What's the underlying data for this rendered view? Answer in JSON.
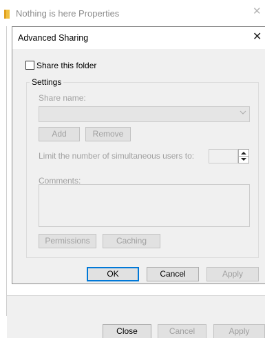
{
  "outer_window": {
    "title": "Nothing is here Properties",
    "close_glyph": "✕",
    "folder_icon": "folder-icon",
    "buttons": {
      "close": "Close",
      "cancel": "Cancel",
      "apply": "Apply"
    }
  },
  "dialog": {
    "title": "Advanced Sharing",
    "close_glyph": "✕",
    "share_checkbox": {
      "label": "Share this folder",
      "checked": false
    },
    "settings": {
      "legend": "Settings",
      "share_name_label": "Share name:",
      "share_name_value": "",
      "add_label": "Add",
      "remove_label": "Remove",
      "limit_label": "Limit the number of simultaneous users to:",
      "limit_value": "",
      "comments_label": "Comments:",
      "comments_value": "",
      "permissions_label": "Permissions",
      "caching_label": "Caching"
    },
    "buttons": {
      "ok": "OK",
      "cancel": "Cancel",
      "apply": "Apply"
    }
  },
  "colors": {
    "dialog_bg": "#f0f0f0",
    "disabled_text": "#a0a0a0",
    "default_button_border": "#0078d7",
    "folder_icon": "#f0c040"
  }
}
